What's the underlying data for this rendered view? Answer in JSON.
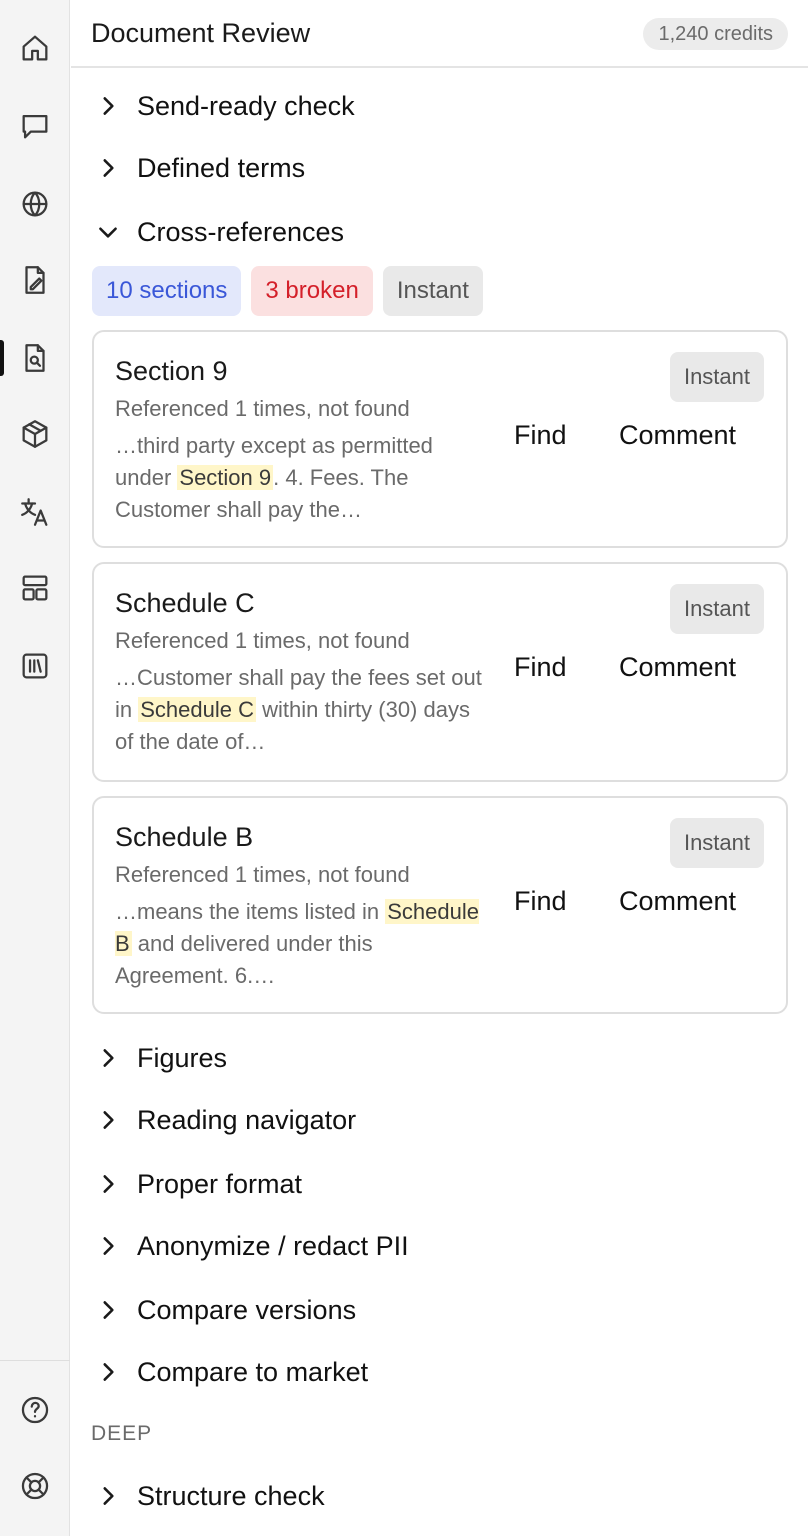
{
  "header": {
    "title": "Document Review",
    "credits": "1,240 credits"
  },
  "rail": {
    "items": [
      {
        "icon": "home-icon"
      },
      {
        "icon": "chat-icon"
      },
      {
        "icon": "globe-icon"
      },
      {
        "icon": "file-edit-icon"
      },
      {
        "icon": "file-search-icon",
        "active": true
      },
      {
        "icon": "box-icon"
      },
      {
        "icon": "translate-icon"
      },
      {
        "icon": "layout-icon"
      },
      {
        "icon": "library-icon"
      }
    ],
    "bottom": [
      {
        "icon": "help-icon"
      },
      {
        "icon": "lifebuoy-icon"
      }
    ]
  },
  "sections": {
    "send_ready": "Send-ready check",
    "defined_terms": "Defined terms",
    "cross_refs": "Cross-references",
    "figures": "Figures",
    "reading_navigator": "Reading navigator",
    "proper_format": "Proper format",
    "anonymize": "Anonymize / redact PII",
    "compare_versions": "Compare versions",
    "compare_market": "Compare to market",
    "deep_label": "DEEP",
    "structure_check": "Structure check"
  },
  "cross_refs": {
    "badges": {
      "sections": "10 sections",
      "broken": "3 broken",
      "mode": "Instant"
    },
    "cards": [
      {
        "title": "Section 9",
        "meta": "Referenced 1 times, not found",
        "before": "…third party except as permitted under ",
        "highlight": "Section 9",
        "after": ". 4. Fees. The Customer shall pay the…",
        "tag": "Instant",
        "find": "Find",
        "comment": "Comment"
      },
      {
        "title": "Schedule C",
        "meta": "Referenced 1 times, not found",
        "before": "…Customer shall pay the fees set out in ",
        "highlight": "Schedule C",
        "after": " within thirty (30) days of the date of…",
        "tag": "Instant",
        "find": "Find",
        "comment": "Comment"
      },
      {
        "title": "Schedule B",
        "meta": "Referenced 1 times, not found",
        "before": "…means the items listed in ",
        "highlight": "Schedule B",
        "after": " and delivered under this Agreement. 6.…",
        "tag": "Instant",
        "find": "Find",
        "comment": "Comment"
      }
    ]
  }
}
